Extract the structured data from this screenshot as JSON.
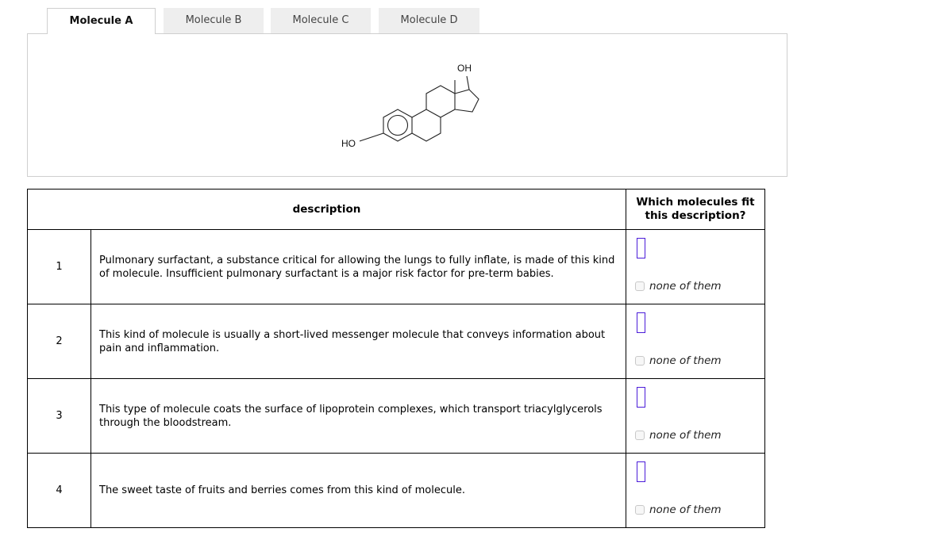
{
  "tabs": [
    {
      "label": "Molecule A",
      "active": true
    },
    {
      "label": "Molecule B",
      "active": false
    },
    {
      "label": "Molecule C",
      "active": false
    },
    {
      "label": "Molecule D",
      "active": false
    }
  ],
  "molecule": {
    "name": "Molecule A",
    "labels": {
      "top_hydroxyl": "OH",
      "bottom_hydroxyl": "HO"
    }
  },
  "table": {
    "header_description": "description",
    "header_which": "Which molecules fit this description?",
    "none_label": "none of them",
    "rows": [
      {
        "index": "1",
        "description": "Pulmonary surfactant, a substance critical for allowing the lungs to fully inflate, is made of this kind of molecule. Insufficient pulmonary surfactant is a major risk factor for pre-term babies.",
        "none_checked": false
      },
      {
        "index": "2",
        "description": "This kind of molecule is usually a short-lived messenger molecule that conveys information about pain and inflammation.",
        "none_checked": false
      },
      {
        "index": "3",
        "description": "This type of molecule coats the surface of lipoprotein complexes, which transport triacylglycerols through the bloodstream.",
        "none_checked": false
      },
      {
        "index": "4",
        "description": "The sweet taste of fruits and berries comes from this kind of molecule.",
        "none_checked": false
      }
    ]
  },
  "colors": {
    "drop_zone_border": "#4b1cd9",
    "tab_inactive_bg": "#eeeeee",
    "panel_border": "#cfcfcf"
  }
}
